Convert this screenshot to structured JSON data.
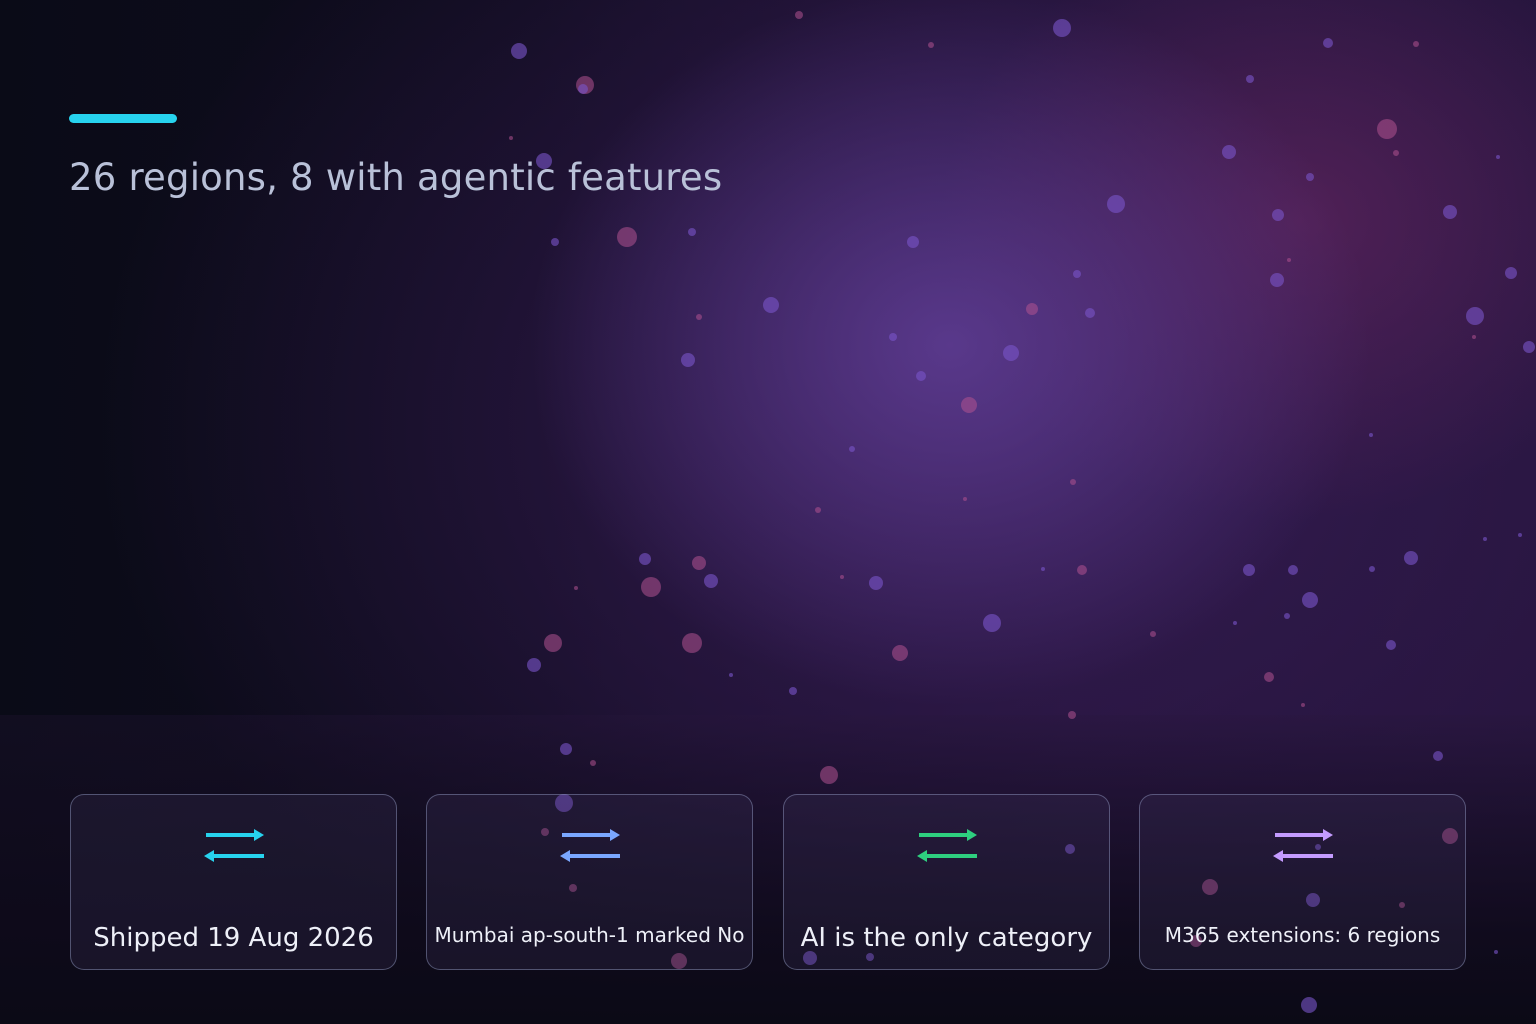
{
  "header": {
    "headline": "26 regions, 8 with agentic features",
    "accent_color": "#27d3ee"
  },
  "cards": [
    {
      "label": "Shipped 19 Aug 2026",
      "icon": "swap-arrows-icon",
      "icon_color": "#27d3ee"
    },
    {
      "label": "Mumbai ap-south-1 marked No",
      "icon": "swap-arrows-icon",
      "icon_color": "#7aa7ff"
    },
    {
      "label": "AI is the only category",
      "icon": "swap-arrows-icon",
      "icon_color": "#2ecf7f"
    },
    {
      "label": "M365 extensions: 6 regions",
      "icon": "swap-arrows-icon",
      "icon_color": "#c49bff"
    }
  ]
}
